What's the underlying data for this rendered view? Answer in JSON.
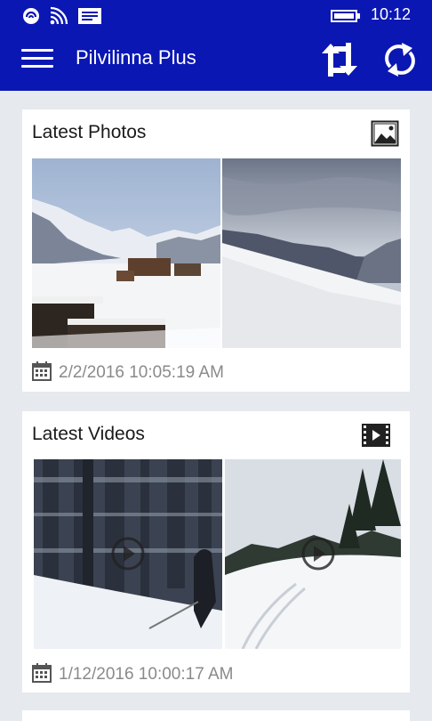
{
  "status": {
    "time": "10:12",
    "icons": [
      "vibrate-icon",
      "wifi-icon",
      "message-icon",
      "battery-icon"
    ]
  },
  "app_bar": {
    "title": "Pilvilinna Plus",
    "icons": [
      "hamburger-menu-icon",
      "swap-icon",
      "refresh-icon"
    ],
    "color": "#0a17b3"
  },
  "photos_card": {
    "title": "Latest Photos",
    "icon": "image-icon",
    "date": "2/2/2016 10:05:19 AM"
  },
  "videos_card": {
    "title": "Latest Videos",
    "icon": "film-icon",
    "date": "1/12/2016 10:00:17 AM"
  }
}
